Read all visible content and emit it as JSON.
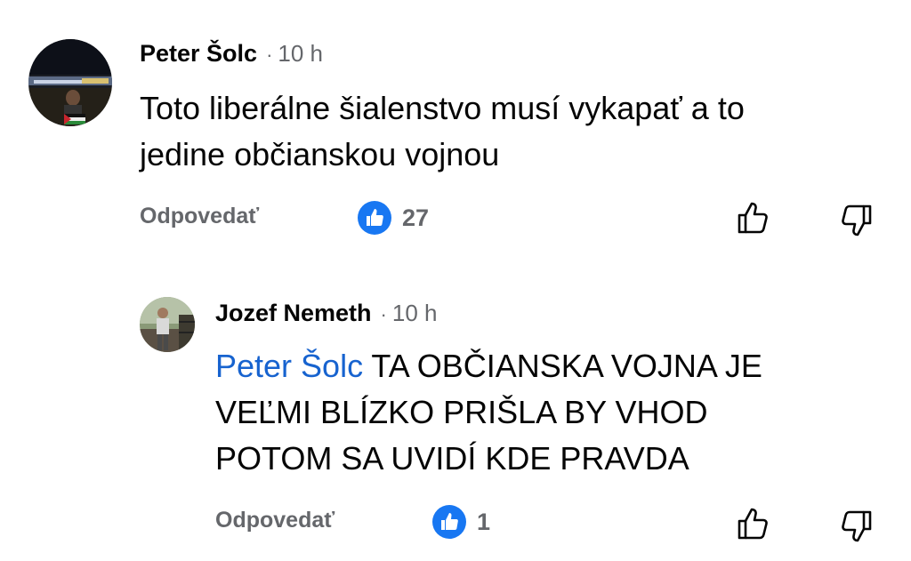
{
  "comments": [
    {
      "author": "Peter Šolc",
      "time": "10 h",
      "separator": "·",
      "text_lines": [
        "Toto liberálne šialenstvo musí vykapať a to",
        "jedine občianskou vojnou"
      ],
      "reply_label": "Odpovedať",
      "like_count": "27"
    }
  ],
  "reply": {
    "author": "Jozef Nemeth",
    "time": "10 h",
    "separator": "·",
    "mention": "Peter Šolc",
    "text_first": " TA OBČIANSKA VOJNA JE",
    "text_lines": [
      "VEĽMI BLÍZKO PRIŠLA BY VHOD",
      "POTOM SA UVIDÍ KDE PRAVDA"
    ],
    "reply_label": "Odpovedať",
    "like_count": "1"
  },
  "colors": {
    "like_blue": "#1877f2",
    "mention_blue": "#1763cf",
    "secondary_text": "#65676b"
  },
  "icons": [
    "like-badge-icon",
    "thumbs-up-outline-icon",
    "thumbs-down-outline-icon"
  ]
}
